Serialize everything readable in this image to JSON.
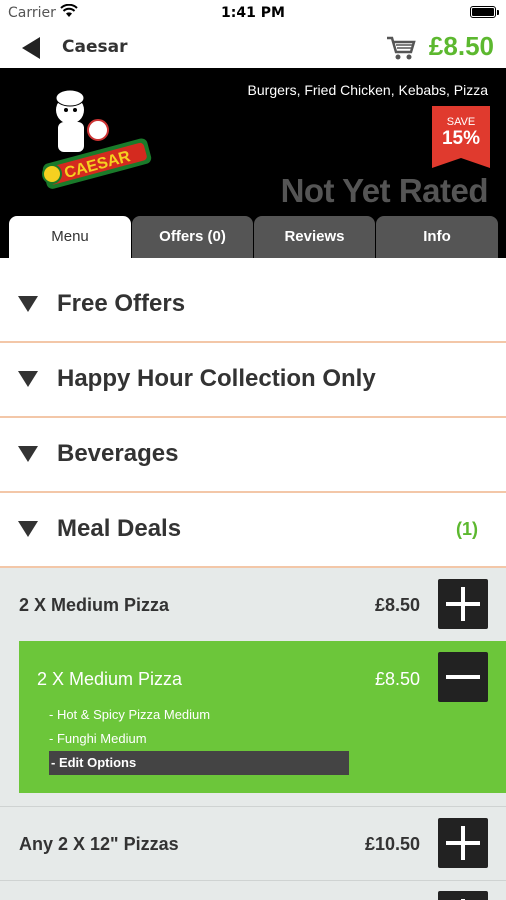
{
  "status_bar": {
    "carrier": "Carrier",
    "time": "1:41 PM"
  },
  "nav": {
    "title": "Caesar",
    "cart_total": "£8.50",
    "cart_icon": "cart-icon",
    "back_icon": "back-arrow-icon"
  },
  "header": {
    "cuisines": "Burgers, Fried Chicken, Kebabs, Pizza",
    "save_label": "SAVE",
    "save_percent": "15%",
    "rating": "Not Yet Rated",
    "logo_text": "CAESAR"
  },
  "tabs": [
    {
      "label": "Menu",
      "active": true
    },
    {
      "label": "Offers (0)",
      "active": false
    },
    {
      "label": "Reviews",
      "active": false
    },
    {
      "label": "Info",
      "active": false
    }
  ],
  "categories": [
    {
      "label": "Free Offers",
      "count": ""
    },
    {
      "label": "Happy Hour Collection Only",
      "count": ""
    },
    {
      "label": "Beverages",
      "count": ""
    },
    {
      "label": "Meal Deals",
      "count": "(1)"
    }
  ],
  "items": [
    {
      "name": "2 X Medium Pizza",
      "price": "£8.50"
    },
    {
      "name": "Any 2 X 12\" Pizzas",
      "price": "£10.50"
    }
  ],
  "selected_item": {
    "name": "2 X Medium Pizza",
    "price": "£8.50",
    "options": [
      "- Hot & Spicy Pizza Medium",
      "- Funghi Medium"
    ],
    "edit_label": "- Edit Options"
  },
  "colors": {
    "accent": "#5cb82f",
    "selected_bg": "#6cc63a",
    "header_bg": "#000000",
    "save_badge": "#e03a2e"
  }
}
